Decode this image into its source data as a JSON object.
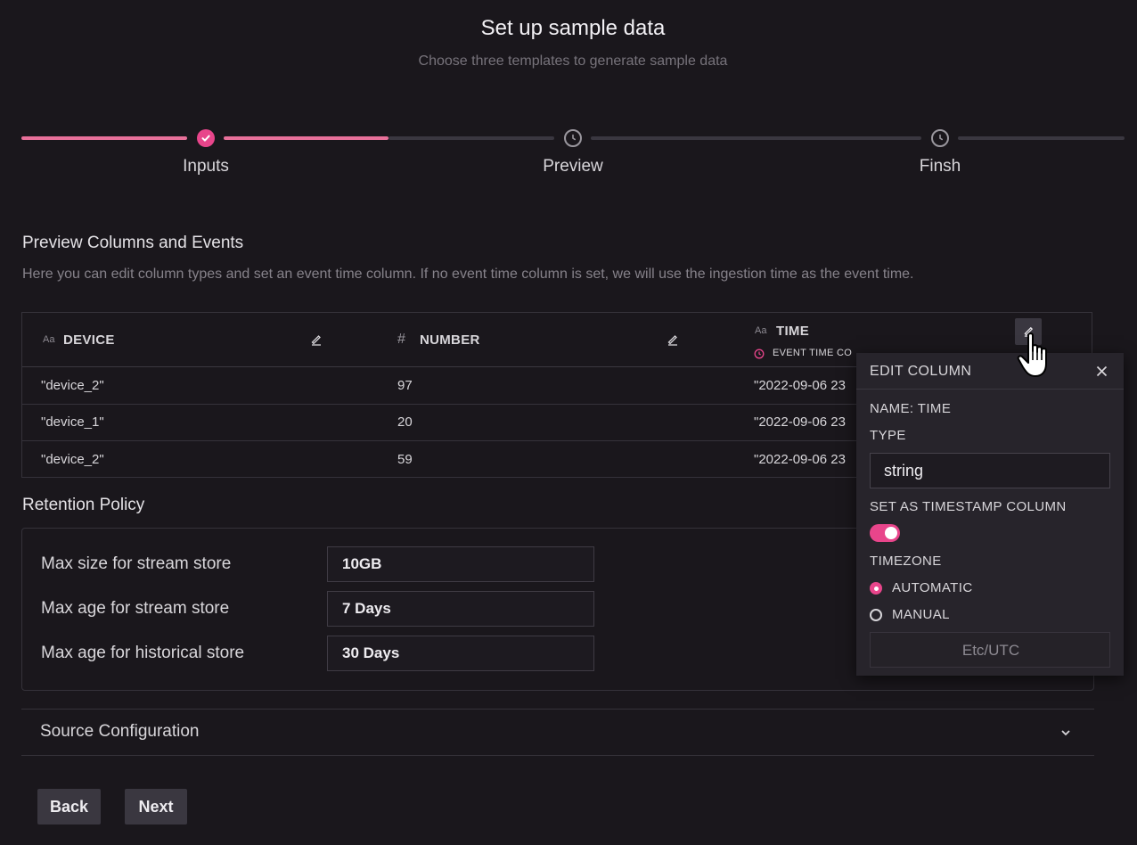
{
  "header": {
    "title": "Set up sample data",
    "subtitle": "Choose three templates to generate sample data"
  },
  "stepper": {
    "steps": [
      {
        "label": "Inputs",
        "status": "complete",
        "icon": "check-icon"
      },
      {
        "label": "Preview",
        "status": "pending",
        "icon": "clock-icon"
      },
      {
        "label": "Finsh",
        "status": "pending",
        "icon": "clock-icon"
      }
    ],
    "accent_color": "#e8709a"
  },
  "preview": {
    "title": "Preview Columns and Events",
    "description": "Here you can edit column types and set an event time column. If no event time column is set, we will use the ingestion time as the event time.",
    "columns": [
      {
        "type_glyph": "Aa",
        "name": "DEVICE"
      },
      {
        "type_glyph": "#",
        "name": "NUMBER"
      },
      {
        "type_glyph": "Aa",
        "name": "TIME",
        "badge": "EVENT TIME COLUMN"
      }
    ],
    "rows": [
      [
        "\"device_2\"",
        "97",
        "\"2022-09-06 23"
      ],
      [
        "\"device_1\"",
        "20",
        "\"2022-09-06 23"
      ],
      [
        "\"device_2\"",
        "59",
        "\"2022-09-06 23"
      ]
    ]
  },
  "retention": {
    "title": "Retention Policy",
    "fields": [
      {
        "label": "Max size for stream store",
        "value": "10GB"
      },
      {
        "label": "Max age for stream store",
        "value": "7 Days"
      },
      {
        "label": "Max age for historical store",
        "value": "30 Days"
      }
    ]
  },
  "source_config": {
    "title": "Source Configuration"
  },
  "footer": {
    "back_label": "Back",
    "next_label": "Next"
  },
  "edit_column": {
    "title": "EDIT COLUMN",
    "name_line": "NAME: TIME",
    "type_label": "TYPE",
    "type_value": "string",
    "timestamp_label": "SET AS TIMESTAMP COLUMN",
    "timestamp_on": true,
    "timezone_label": "TIMEZONE",
    "options": [
      {
        "label": "AUTOMATIC",
        "selected": true
      },
      {
        "label": "MANUAL",
        "selected": false
      }
    ],
    "timezone_value": "Etc/UTC"
  },
  "colors": {
    "accent": "#e8458b",
    "background": "#1a171c"
  }
}
